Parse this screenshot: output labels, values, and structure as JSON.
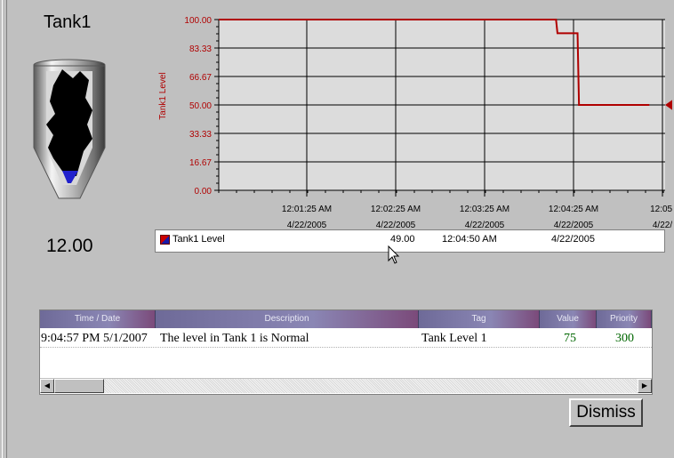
{
  "tank": {
    "title": "Tank1",
    "value": "12.00",
    "icon": "conical-tank-icon"
  },
  "chart_data": {
    "type": "line",
    "ylabel": "Tank1 Level",
    "yticks": [
      "100.00",
      "83.33",
      "66.67",
      "50.00",
      "33.33",
      "16.67",
      "0.00"
    ],
    "ylim": [
      0,
      100
    ],
    "xticks": [
      {
        "time": "12:01:25 AM",
        "date": "4/22/2005"
      },
      {
        "time": "12:02:25 AM",
        "date": "4/22/2005"
      },
      {
        "time": "12:03:25 AM",
        "date": "4/22/2005"
      },
      {
        "time": "12:04:25 AM",
        "date": "4/22/2005"
      },
      {
        "time": "12:05:",
        "date": "4/22/"
      }
    ],
    "series": [
      {
        "name": "Tank1 Level",
        "color": "#b00000",
        "points": [
          {
            "x": "12:00:25 AM",
            "y": 100
          },
          {
            "x": "12:04:20 AM",
            "y": 100
          },
          {
            "x": "12:04:21 AM",
            "y": 92
          },
          {
            "x": "12:04:35 AM",
            "y": 92
          },
          {
            "x": "12:04:36 AM",
            "y": 50
          },
          {
            "x": "12:05:25 AM",
            "y": 50
          }
        ]
      }
    ],
    "grid": true,
    "background": "#dcdcdc"
  },
  "legend": {
    "name": "Tank1 Level",
    "value": "49.00",
    "time": "12:04:50 AM",
    "date": "4/22/2005"
  },
  "alarms": {
    "columns": [
      "Time / Date",
      "Description",
      "Tag",
      "Value",
      "Priority"
    ],
    "rows": [
      {
        "time_date": "9:04:57 PM  5/1/2007",
        "description": "The level in Tank 1 is Normal",
        "tag": "Tank Level 1",
        "value": "75",
        "priority": "300"
      }
    ]
  },
  "buttons": {
    "dismiss": "Dismiss"
  },
  "colors": {
    "trend_line": "#b00000",
    "tank_fill": "#2020cc"
  }
}
